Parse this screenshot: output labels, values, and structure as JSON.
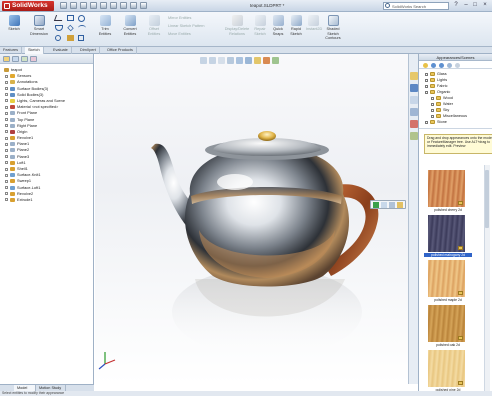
{
  "app": {
    "name": "SolidWorks",
    "document_title": "teapot.SLDPRT *",
    "search_placeholder": "SolidWorks Search",
    "help_label": "?"
  },
  "ribbon": {
    "sketch": "Sketch",
    "smart_dimension": "Smart Dimension",
    "trim_entities": "Trim Entities",
    "convert_entities": "Convert Entities",
    "offset_entities": "Offset Entities",
    "mirror_entities": "Mirror Entities",
    "linear_sketch_pattern": "Linear Sketch Pattern",
    "move_entities": "Move Entities",
    "display_delete_relations": "Display/Delete Relations",
    "repair_sketch": "Repair Sketch",
    "quick_snaps": "Quick Snaps",
    "rapid_sketch": "Rapid Sketch",
    "instant2d": "Instant2D",
    "shaded_sketch_contours": "Shaded Sketch Contours"
  },
  "command_tabs": [
    "Features",
    "Sketch",
    "Evaluate",
    "DimXpert",
    "Office Products"
  ],
  "feature_tree": [
    {
      "label": "teapot",
      "depth": 0,
      "color": "#c89b3a"
    },
    {
      "label": "Sensors",
      "depth": 1,
      "color": "#e0a830"
    },
    {
      "label": "Annotations",
      "depth": 1,
      "color": "#d8b24a"
    },
    {
      "label": "Surface Bodies(3)",
      "depth": 1,
      "color": "#5f8fc4"
    },
    {
      "label": "Solid Bodies(3)",
      "depth": 1,
      "color": "#5f8fc4"
    },
    {
      "label": "Lights, Cameras and Scene",
      "depth": 1,
      "color": "#e8d040"
    },
    {
      "label": "Material <not specified>",
      "depth": 1,
      "color": "#c04a3a"
    },
    {
      "label": "Front Plane",
      "depth": 1,
      "color": "#9bb0c8"
    },
    {
      "label": "Top Plane",
      "depth": 1,
      "color": "#9bb0c8"
    },
    {
      "label": "Right Plane",
      "depth": 1,
      "color": "#9bb0c8"
    },
    {
      "label": "Origin",
      "depth": 1,
      "color": "#b04040"
    },
    {
      "label": "Revolve1",
      "depth": 1,
      "color": "#d8a030"
    },
    {
      "label": "Plane1",
      "depth": 1,
      "color": "#9bb0c8"
    },
    {
      "label": "Plane2",
      "depth": 1,
      "color": "#9bb0c8"
    },
    {
      "label": "Plane3",
      "depth": 1,
      "color": "#9bb0c8"
    },
    {
      "label": "Loft1",
      "depth": 1,
      "color": "#d8a030"
    },
    {
      "label": "Shell1",
      "depth": 1,
      "color": "#d8a030"
    },
    {
      "label": "Surface-Knit1",
      "depth": 1,
      "color": "#6fa0d0"
    },
    {
      "label": "Sweep1",
      "depth": 1,
      "color": "#d8a030"
    },
    {
      "label": "Surface-Loft1",
      "depth": 1,
      "color": "#6fa0d0"
    },
    {
      "label": "Revolve2",
      "depth": 1,
      "color": "#d8a030"
    },
    {
      "label": "Extrude1",
      "depth": 1,
      "color": "#d8a030"
    }
  ],
  "bottom_tabs": [
    "Model",
    "Motion Study 1"
  ],
  "status_text": "Select entities to modify their appearance",
  "task_pane": {
    "title": "Appearances/Scenes",
    "tree": [
      {
        "label": "Glass",
        "depth": 1
      },
      {
        "label": "Lights",
        "depth": 1
      },
      {
        "label": "Fabric",
        "depth": 1
      },
      {
        "label": "Organic",
        "depth": 1
      },
      {
        "label": "Wood",
        "depth": 2
      },
      {
        "label": "Water",
        "depth": 2
      },
      {
        "label": "Sky",
        "depth": 2
      },
      {
        "label": "Miscellaneous",
        "depth": 2
      },
      {
        "label": "Stone",
        "depth": 1
      }
    ],
    "tooltip": "Drag and drop appearances onto the model or FeatureManager tree. Use ALT+drag to immediately edit. Preview",
    "swatches": [
      {
        "label": "polished cherry 2d",
        "color_a": "#e2a26a",
        "color_b": "#c27240",
        "selected": false
      },
      {
        "label": "polished mahogany 2d",
        "color_a": "#3b3a5a",
        "color_b": "#5a5a7a",
        "selected": true
      },
      {
        "label": "polished maple 2d",
        "color_a": "#f1c98a",
        "color_b": "#dca160",
        "selected": false
      },
      {
        "label": "polished oak 2d",
        "color_a": "#d6a55a",
        "color_b": "#b9833a",
        "selected": false
      },
      {
        "label": "polished pine 2d",
        "color_a": "#f4dca4",
        "color_b": "#e8c680",
        "selected": false
      }
    ]
  }
}
